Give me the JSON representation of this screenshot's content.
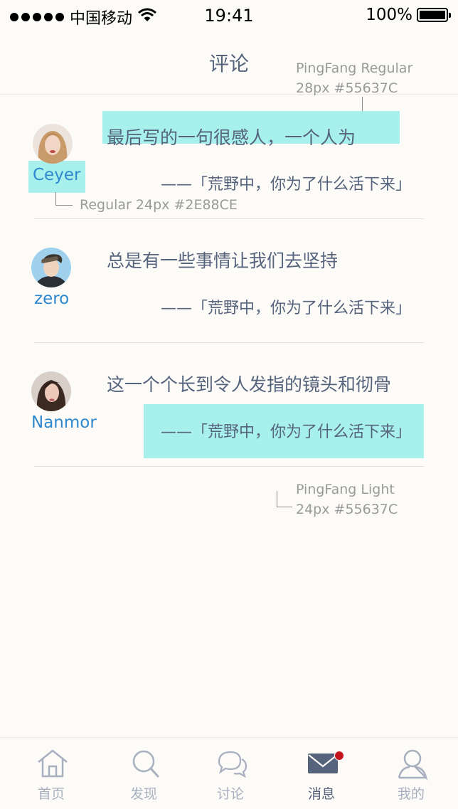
{
  "status_bar": {
    "carrier": "中国移动",
    "time": "19:41",
    "battery": "100%"
  },
  "nav": {
    "title": "评论"
  },
  "annotations": {
    "title_font": "PingFang Regular",
    "title_spec": "28px #55637C",
    "username_spec": "Regular 24px #2E88CE",
    "quote_font": "PingFang Light",
    "quote_spec": "24px #55637C"
  },
  "comments": [
    {
      "user": "Ceyer",
      "text": "最后写的一句很感人，一个人为",
      "quote": "——「荒野中，你为了什么活下来」"
    },
    {
      "user": "zero",
      "text": "总是有一些事情让我们去坚持",
      "quote": "——「荒野中，你为了什么活下来」"
    },
    {
      "user": "Nanmor",
      "text": "这一个个长到令人发指的镜头和彻骨",
      "quote": "——「荒野中，你为了什么活下来」"
    }
  ],
  "tabs": [
    {
      "label": "首页",
      "icon": "home-icon"
    },
    {
      "label": "发现",
      "icon": "search-icon"
    },
    {
      "label": "讨论",
      "icon": "chat-bubbles-icon"
    },
    {
      "label": "消息",
      "icon": "mail-icon",
      "active": true,
      "badge": true
    },
    {
      "label": "我的",
      "icon": "user-icon"
    }
  ],
  "colors": {
    "text": "#55637C",
    "username": "#2E88CE",
    "highlight": "#a8f0ec",
    "badge": "#c6141f"
  }
}
